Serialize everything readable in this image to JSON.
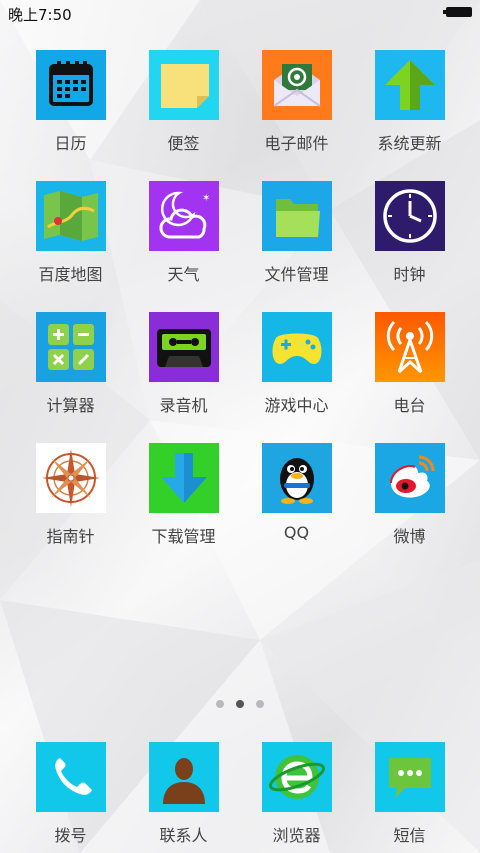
{
  "status_bar": {
    "time": "晚上7:50"
  },
  "apps": [
    {
      "label": "日历",
      "icon": "calendar-icon",
      "color": "#12a7e6"
    },
    {
      "label": "便签",
      "icon": "sticky-note-icon",
      "color": "#20d6f0"
    },
    {
      "label": "电子邮件",
      "icon": "email-icon",
      "color": "#ff7a1a"
    },
    {
      "label": "系统更新",
      "icon": "system-update-arrow-icon",
      "color": "#1cb8ef"
    },
    {
      "label": "百度地图",
      "icon": "map-icon",
      "color": "#18b6e8"
    },
    {
      "label": "天气",
      "icon": "weather-moon-cloud-icon",
      "color": "#a233f0"
    },
    {
      "label": "文件管理",
      "icon": "folder-icon",
      "color": "#1ca8e8"
    },
    {
      "label": "时钟",
      "icon": "clock-icon",
      "color": "#2e1b6b"
    },
    {
      "label": "计算器",
      "icon": "calculator-icon",
      "color": "#19a1e2"
    },
    {
      "label": "录音机",
      "icon": "cassette-recorder-icon",
      "color": "#8a2dd8"
    },
    {
      "label": "游戏中心",
      "icon": "gamepad-icon",
      "color": "#14b7e6"
    },
    {
      "label": "电台",
      "icon": "radio-tower-icon",
      "color": "#ff6a00"
    },
    {
      "label": "指南针",
      "icon": "compass-icon",
      "color": "#ffffff"
    },
    {
      "label": "下载管理",
      "icon": "download-arrow-icon",
      "color": "#34d02a"
    },
    {
      "label": "QQ",
      "icon": "qq-penguin-icon",
      "color": "#1fa6e0"
    },
    {
      "label": "微博",
      "icon": "weibo-icon",
      "color": "#1aa7e3"
    }
  ],
  "page_indicator": {
    "count": 3,
    "active_index": 1
  },
  "dock": [
    {
      "label": "拨号",
      "icon": "phone-icon",
      "color": "#11c7ea"
    },
    {
      "label": "联系人",
      "icon": "contact-person-icon",
      "color": "#11c7ea"
    },
    {
      "label": "浏览器",
      "icon": "browser-e-icon",
      "color": "#11c7ea"
    },
    {
      "label": "短信",
      "icon": "sms-message-icon",
      "color": "#11c7ea"
    }
  ]
}
